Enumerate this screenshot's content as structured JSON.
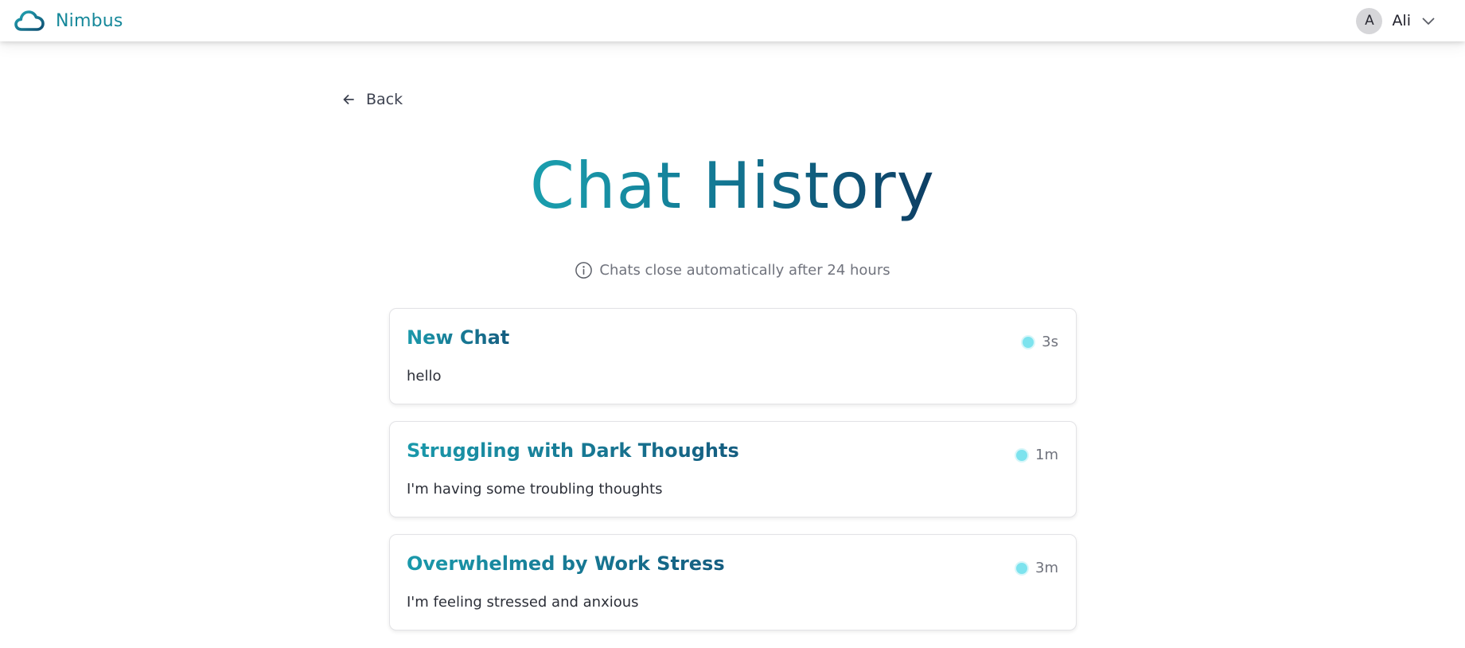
{
  "header": {
    "brand_name": "Nimbus",
    "logo_icon": "cloud-icon",
    "user": {
      "avatar_initial": "A",
      "name": "Ali",
      "menu_icon": "chevron-down-icon"
    }
  },
  "nav": {
    "back_label": "Back",
    "back_icon": "arrow-left-icon"
  },
  "page": {
    "title": "Chat History",
    "notice_icon": "info-icon",
    "notice": "Chats close automatically after 24 hours"
  },
  "chats": [
    {
      "title": "New Chat",
      "preview": "hello",
      "time": "3s",
      "status": "active"
    },
    {
      "title": "Struggling with Dark Thoughts",
      "preview": "I'm having some troubling thoughts",
      "time": "1m",
      "status": "active"
    },
    {
      "title": "Overwhelmed by Work Stress",
      "preview": "I'm feeling stressed and anxious",
      "time": "3m",
      "status": "active"
    }
  ],
  "colors": {
    "brand": "#16889a",
    "title_gradient_start": "#1a9fae",
    "title_gradient_end": "#0d3d63",
    "status_active": "#7de3ee"
  }
}
